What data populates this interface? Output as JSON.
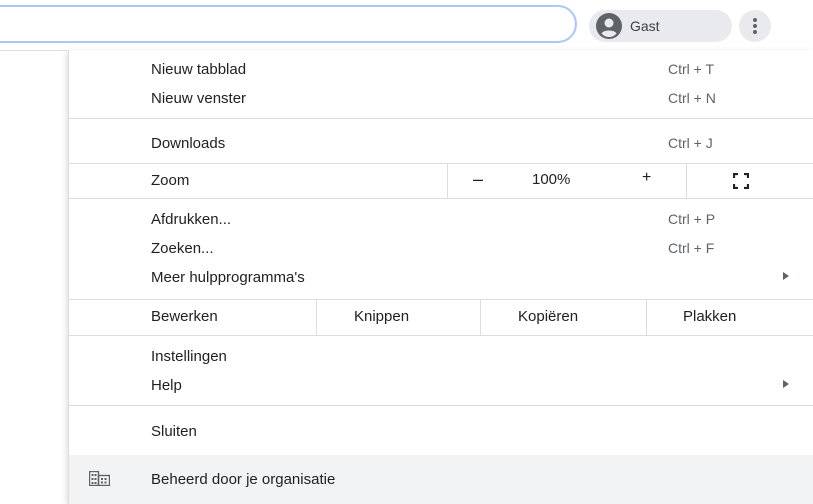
{
  "profile": {
    "name": "Gast"
  },
  "menu": {
    "new_tab": {
      "label": "Nieuw tabblad",
      "shortcut": "Ctrl + T"
    },
    "new_window": {
      "label": "Nieuw venster",
      "shortcut": "Ctrl + N"
    },
    "downloads": {
      "label": "Downloads",
      "shortcut": "Ctrl + J"
    },
    "zoom": {
      "label": "Zoom",
      "minus": "–",
      "value": "100%",
      "plus": "+"
    },
    "print": {
      "label": "Afdrukken...",
      "shortcut": "Ctrl + P"
    },
    "find": {
      "label": "Zoeken...",
      "shortcut": "Ctrl + F"
    },
    "more_tools": {
      "label": "Meer hulpprogramma's"
    },
    "edit": {
      "label": "Bewerken",
      "cut": "Knippen",
      "copy": "Kopiëren",
      "paste": "Plakken"
    },
    "settings": {
      "label": "Instellingen"
    },
    "help": {
      "label": "Help"
    },
    "exit": {
      "label": "Sluiten"
    },
    "managed": {
      "label": "Beheerd door je organisatie"
    }
  }
}
